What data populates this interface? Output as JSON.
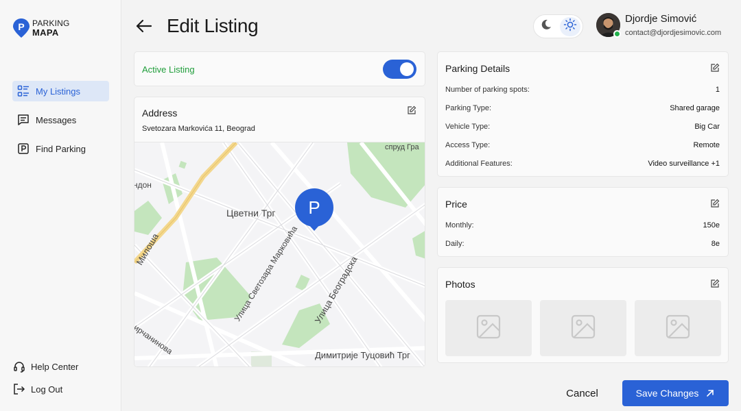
{
  "brand": {
    "line1": "PARKING",
    "line2": "MAPA",
    "color": "#2a62d6"
  },
  "sidebar": {
    "items": [
      {
        "label": "My Listings",
        "icon": "list-icon",
        "active": true
      },
      {
        "label": "Messages",
        "icon": "message-icon"
      },
      {
        "label": "Find Parking",
        "icon": "parking-icon"
      }
    ],
    "bottom": [
      {
        "label": "Help Center",
        "icon": "headset-icon"
      },
      {
        "label": "Log Out",
        "icon": "logout-icon"
      }
    ]
  },
  "header": {
    "title": "Edit Listing"
  },
  "user": {
    "name": "Djordje Simović",
    "email": "contact@djordjesimovic.com",
    "status": "online"
  },
  "listing": {
    "active_label": "Active Listing",
    "active": true,
    "address_title": "Address",
    "address": "Svetozara Markovića 11, Beograd",
    "map": {
      "labels": [
        "ндон",
        "Цветни Трг",
        "спруд Гра",
        "Милоша",
        "Улица Светозара Марковића",
        "Улица Београдска",
        "ирчанинова",
        "Димитрије Туцовић Трг"
      ],
      "pin_letter": "P"
    }
  },
  "parking_details": {
    "title": "Parking Details",
    "rows": [
      {
        "key": "Number of parking spots:",
        "value": "1"
      },
      {
        "key": "Parking Type:",
        "value": "Shared garage"
      },
      {
        "key": "Vehicle Type:",
        "value": "Big Car"
      },
      {
        "key": "Access Type:",
        "value": "Remote"
      },
      {
        "key": "Additional Features:",
        "value": "Video surveillance +1"
      }
    ]
  },
  "price": {
    "title": "Price",
    "rows": [
      {
        "key": "Monthly:",
        "value": "150e"
      },
      {
        "key": "Daily:",
        "value": "8e"
      }
    ]
  },
  "photos": {
    "title": "Photos"
  },
  "actions": {
    "cancel": "Cancel",
    "save": "Save Changes"
  },
  "colors": {
    "accent": "#2a62d6",
    "success": "#1f9d3a",
    "park": "#bfe3b8",
    "road_major": "#f4d27a"
  }
}
